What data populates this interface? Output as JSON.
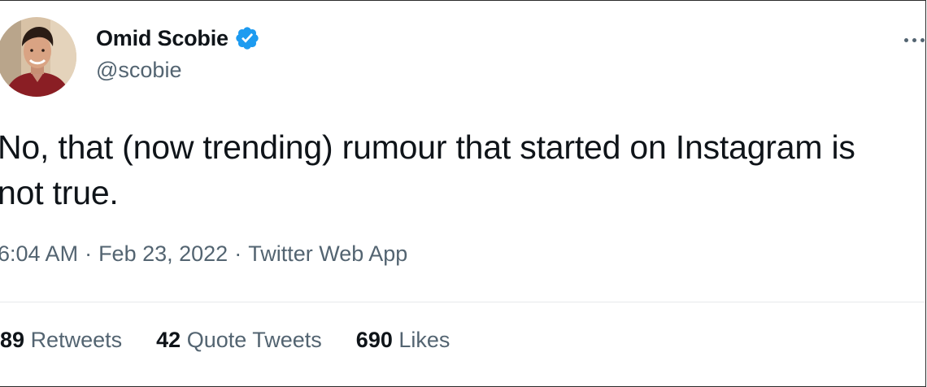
{
  "author": {
    "display_name": "Omid Scobie",
    "handle": "@scobie",
    "verified": true,
    "verified_color": "#1d9bf0",
    "avatar_icon": "profile-photo"
  },
  "tweet": {
    "text": "No, that (now trending) rumour that started on Instagram is not true.",
    "time": "6:04 AM",
    "date": "Feb 23, 2022",
    "separator": "·",
    "source": "Twitter Web App"
  },
  "stats": {
    "retweets_count": "89",
    "retweets_label": "Retweets",
    "quotes_count": "42",
    "quotes_label": "Quote Tweets",
    "likes_count": "690",
    "likes_label": "Likes"
  },
  "menu": {
    "more_icon": "more-horizontal-icon"
  }
}
